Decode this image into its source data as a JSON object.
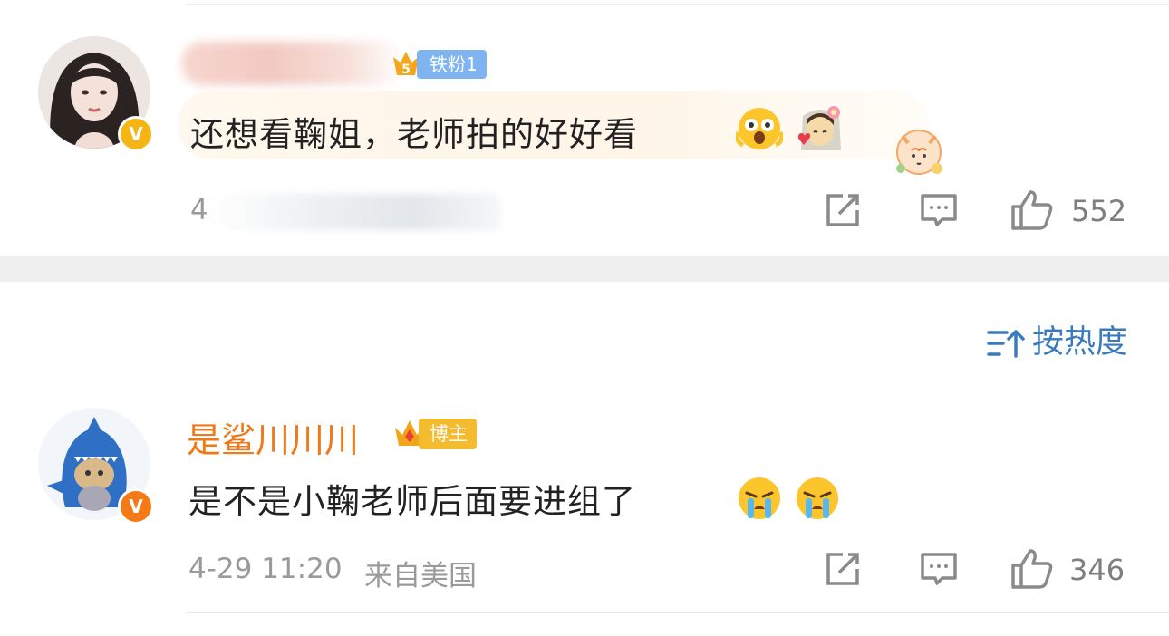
{
  "comments": [
    {
      "fan_badge": "铁粉1",
      "text": "还想看鞠姐，老师拍的好好看",
      "meta_prefix": "4",
      "likes": "552"
    },
    {
      "username": "是鲨川川川",
      "blogger_badge": "博主",
      "text": "是不是小鞠老师后面要进组了",
      "time": "4-29 11:20",
      "location": "来自美国",
      "likes": "346"
    }
  ],
  "sort": {
    "label": "按热度"
  },
  "colors": {
    "username_orange": "#f07a18",
    "link_blue": "#3a7bbf",
    "fan_tag": "#7fb4f0",
    "blogger_tag": "#f3bb2d",
    "meta_gray": "#9a9a9a"
  },
  "icons": [
    "verified-v-icon",
    "fan-level-icon",
    "share-icon",
    "comment-icon",
    "like-icon",
    "sort-icon",
    "crown-icon",
    "crying-emoji",
    "excited-emoji",
    "bride-emoji",
    "tiger-sticker"
  ]
}
